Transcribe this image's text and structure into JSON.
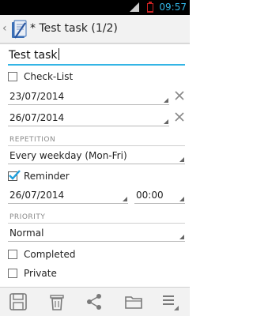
{
  "status_bar": {
    "network": "3G",
    "time": "09:57"
  },
  "action_bar": {
    "title": "* Test task (1/2)"
  },
  "task": {
    "title_value": "Test task"
  },
  "checklist": {
    "label": "Check-List",
    "checked": false
  },
  "start_date": {
    "value": "23/07/2014"
  },
  "due_date": {
    "value": "26/07/2014"
  },
  "repetition": {
    "section_label": "REPETITION",
    "value": "Every weekday (Mon-Fri)"
  },
  "reminder": {
    "label": "Reminder",
    "checked": true,
    "date": "26/07/2014",
    "time": "00:00"
  },
  "priority": {
    "section_label": "PRIORITY",
    "value": "Normal"
  },
  "completed": {
    "label": "Completed",
    "checked": false
  },
  "private": {
    "label": "Private",
    "checked": false
  },
  "bottom_bar": {
    "buttons": [
      "save",
      "delete",
      "share",
      "folder",
      "menu"
    ]
  },
  "colors": {
    "accent": "#33b5e5",
    "check": "#1e9fdc"
  }
}
